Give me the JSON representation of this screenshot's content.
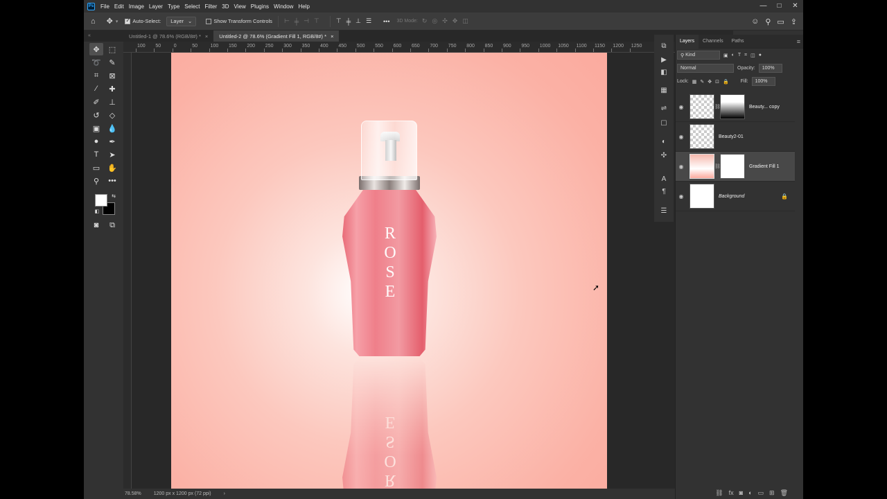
{
  "menu": {
    "logo": "Ps",
    "items": [
      "File",
      "Edit",
      "Image",
      "Layer",
      "Type",
      "Select",
      "Filter",
      "3D",
      "View",
      "Plugins",
      "Window",
      "Help"
    ]
  },
  "window_controls": {
    "minimize": "—",
    "maximize": "□",
    "close": "✕"
  },
  "options": {
    "auto_select_label": "Auto-Select:",
    "auto_select_value": "Layer",
    "transform_label": "Show Transform Controls",
    "mode_3d_label": "3D Mode:",
    "more": "•••"
  },
  "tabs": {
    "collapse": "«",
    "items": [
      {
        "label": "Untitled-1 @ 78.6% (RGB/8#) *",
        "close": "×"
      },
      {
        "label": "Untitled-2 @ 78.6% (Gradient Fill 1, RGB/8#) *",
        "close": "×"
      }
    ]
  },
  "ruler": {
    "labels": [
      "100",
      "50",
      "0",
      "50",
      "100",
      "150",
      "200",
      "250",
      "300",
      "350",
      "400",
      "450",
      "500",
      "550",
      "600",
      "650",
      "700",
      "750",
      "800",
      "850",
      "900",
      "950",
      "1000",
      "1050",
      "1100",
      "1150",
      "1200",
      "1250"
    ]
  },
  "canvas": {
    "label_text": "ROSE",
    "reflection_text": "ROSE"
  },
  "panel": {
    "tabs": [
      "Layers",
      "Channels",
      "Paths"
    ],
    "kind_label": "Kind",
    "blend_mode": "Normal",
    "opacity_label": "Opacity:",
    "opacity_value": "100%",
    "lock_label": "Lock:",
    "fill_label": "Fill:",
    "fill_value": "100%",
    "layers": [
      {
        "name": "Beauty... copy",
        "visible": true,
        "selected": false
      },
      {
        "name": "Beauty2-01",
        "visible": true,
        "selected": false
      },
      {
        "name": "Gradient Fill 1",
        "visible": true,
        "selected": true
      },
      {
        "name": "Background",
        "visible": true,
        "selected": false,
        "locked": true
      }
    ]
  },
  "status": {
    "zoom": "78.58%",
    "doc_size": "1200 px x 1200 px (72 ppi)",
    "arrow": "›"
  },
  "colors": {
    "accent": "#31a8ff",
    "foreground": "#ffffff",
    "background": "#000000",
    "canvas_edge": "#fbaa9e",
    "bottle": "#ee7f8a"
  }
}
